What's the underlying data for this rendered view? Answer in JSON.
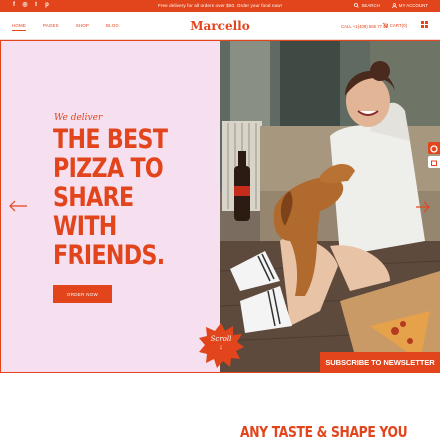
{
  "topbar": {
    "social_icons": [
      "facebook-icon",
      "instagram-icon",
      "twitter-icon",
      "pinterest-icon"
    ],
    "promo": "Free delivery for all orders over $50. Order your food now!",
    "search": "SEARCH",
    "account": "MY ACCOUNT"
  },
  "nav": {
    "links": [
      "HOME",
      "PAGES",
      "SHOP",
      "BLOG"
    ],
    "logo": "Marcello",
    "contact": "CALL +1(408) 555 77 00",
    "cart": "CART(0)"
  },
  "hero": {
    "tagline": "We deliver",
    "headline": "THE BEST PIZZA TO SHARE WITH FRIENDS.",
    "cta": "ORDER NOW",
    "badge": "Scroll",
    "newsletter": "SUBSCRIBE TO NEWSLETTER"
  },
  "section": {
    "title": "ANY TASTE & SHAPE YOU"
  },
  "colors": {
    "accent": "#e2441c",
    "hero_bg": "#f6dfee"
  }
}
